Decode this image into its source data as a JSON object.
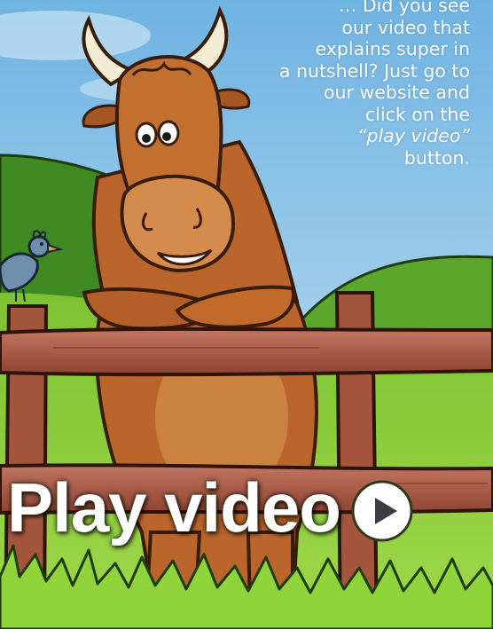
{
  "caption": {
    "line0": "… Did you see",
    "line1": "our video that",
    "line2": "explains super in",
    "line3": "a nutshell? Just go to",
    "line4": "our website and",
    "line5": "click on the",
    "line6": "“play video”",
    "line7": "button."
  },
  "play_button": {
    "label": "Play video",
    "icon": "play-circle-icon"
  },
  "colors": {
    "sky": "#8fc3e6",
    "hills": "#4f9a2a",
    "grass": "#8ccd3a",
    "bull": "#c06a2c",
    "fence": "#a4553b",
    "text": "#ffffff"
  }
}
